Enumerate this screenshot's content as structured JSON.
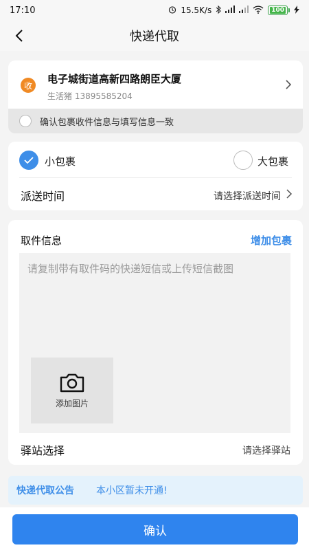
{
  "status_bar": {
    "time": "17:10",
    "net_speed": "15.5K/s",
    "battery": "100"
  },
  "nav": {
    "title": "快递代取"
  },
  "address": {
    "badge": "收",
    "title": "电子城街道高新四路朗臣大厦",
    "subtitle": "生活猪 13895585204",
    "confirm_text": "确认包裹收件信息与填写信息一致"
  },
  "package": {
    "small_label": "小包裹",
    "large_label": "大包裹",
    "selected": "small"
  },
  "delivery": {
    "label": "派送时间",
    "value": "请选择派送时间"
  },
  "pickup": {
    "title": "取件信息",
    "add_label": "增加包裹",
    "placeholder": "请复制带有取件码的快递短信或上传短信截图",
    "add_image_label": "添加图片",
    "station_label": "驿站选择",
    "station_value": "请选择驿站"
  },
  "notice": {
    "title": "快递代取公告",
    "text": "本小区暂未开通!"
  },
  "confirm_button": "确认",
  "colors": {
    "accent": "#2f84ee",
    "badge_orange": "#f08a24",
    "notice_bg": "#e4f2fc"
  }
}
